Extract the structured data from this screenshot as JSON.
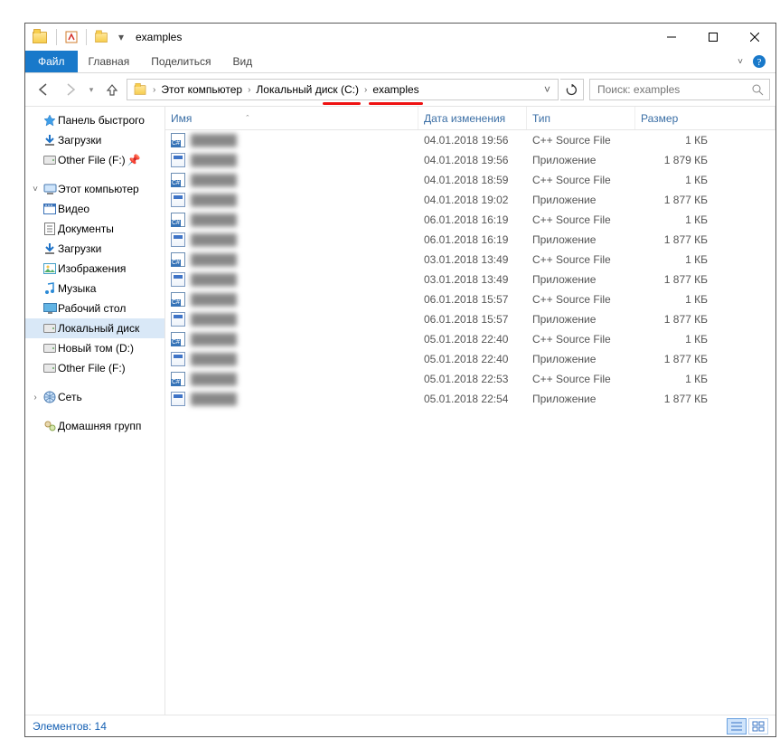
{
  "window": {
    "title": "examples"
  },
  "ribbon": {
    "file": "Файл",
    "tabs": [
      "Главная",
      "Поделиться",
      "Вид"
    ]
  },
  "breadcrumb": {
    "segments": [
      "Этот компьютер",
      "Локальный диск (C:)",
      "examples"
    ]
  },
  "search": {
    "placeholder": "Поиск: examples"
  },
  "sidebar": {
    "quick": {
      "label": "Панель быстрого",
      "items": [
        {
          "label": "Загрузки",
          "icon": "download"
        },
        {
          "label": "Other File (F:)",
          "icon": "drive",
          "pinned": true
        }
      ]
    },
    "thispc": {
      "label": "Этот компьютер",
      "items": [
        {
          "label": "Видео",
          "icon": "video"
        },
        {
          "label": "Документы",
          "icon": "docs"
        },
        {
          "label": "Загрузки",
          "icon": "download"
        },
        {
          "label": "Изображения",
          "icon": "images"
        },
        {
          "label": "Музыка",
          "icon": "music"
        },
        {
          "label": "Рабочий стол",
          "icon": "desktop"
        },
        {
          "label": "Локальный диск",
          "icon": "drive",
          "selected": true
        },
        {
          "label": "Новый том (D:)",
          "icon": "drive"
        },
        {
          "label": "Other File (F:)",
          "icon": "drive"
        }
      ]
    },
    "network": {
      "label": "Сеть"
    },
    "homegroup": {
      "label": "Домашняя групп"
    }
  },
  "columns": {
    "name": "Имя",
    "date": "Дата изменения",
    "type": "Тип",
    "size": "Размер"
  },
  "files": [
    {
      "kind": "cpp",
      "date": "04.01.2018 19:56",
      "type": "C++ Source File",
      "size": "1 КБ"
    },
    {
      "kind": "exe",
      "date": "04.01.2018 19:56",
      "type": "Приложение",
      "size": "1 879 КБ"
    },
    {
      "kind": "cpp",
      "date": "04.01.2018 18:59",
      "type": "C++ Source File",
      "size": "1 КБ"
    },
    {
      "kind": "exe",
      "date": "04.01.2018 19:02",
      "type": "Приложение",
      "size": "1 877 КБ"
    },
    {
      "kind": "cpp",
      "date": "06.01.2018 16:19",
      "type": "C++ Source File",
      "size": "1 КБ"
    },
    {
      "kind": "exe",
      "date": "06.01.2018 16:19",
      "type": "Приложение",
      "size": "1 877 КБ"
    },
    {
      "kind": "cpp",
      "date": "03.01.2018 13:49",
      "type": "C++ Source File",
      "size": "1 КБ"
    },
    {
      "kind": "exe",
      "date": "03.01.2018 13:49",
      "type": "Приложение",
      "size": "1 877 КБ"
    },
    {
      "kind": "cpp",
      "date": "06.01.2018 15:57",
      "type": "C++ Source File",
      "size": "1 КБ"
    },
    {
      "kind": "exe",
      "date": "06.01.2018 15:57",
      "type": "Приложение",
      "size": "1 877 КБ"
    },
    {
      "kind": "cpp",
      "date": "05.01.2018 22:40",
      "type": "C++ Source File",
      "size": "1 КБ"
    },
    {
      "kind": "exe",
      "date": "05.01.2018 22:40",
      "type": "Приложение",
      "size": "1 877 КБ"
    },
    {
      "kind": "cpp",
      "date": "05.01.2018 22:53",
      "type": "C++ Source File",
      "size": "1 КБ"
    },
    {
      "kind": "exe",
      "date": "05.01.2018 22:54",
      "type": "Приложение",
      "size": "1 877 КБ"
    }
  ],
  "status": {
    "count_label": "Элементов: 14"
  }
}
